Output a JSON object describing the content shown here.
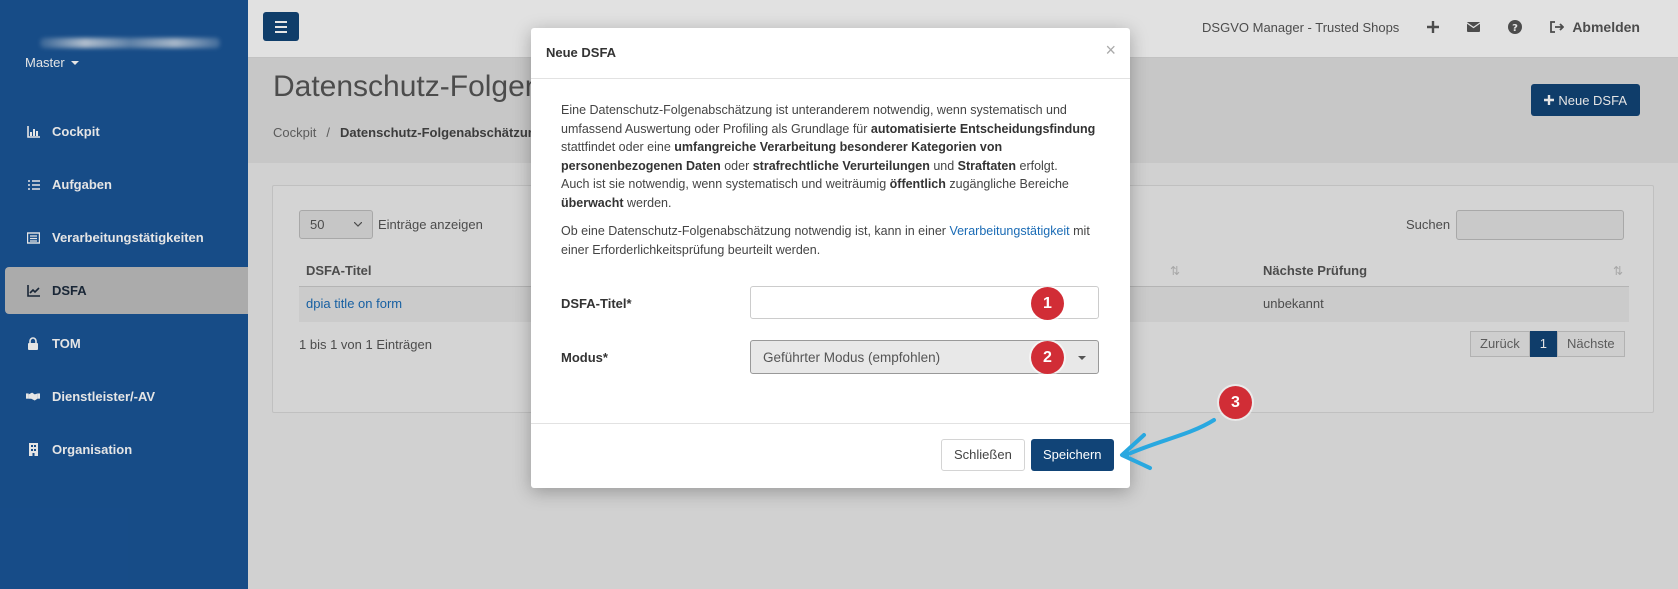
{
  "sidebar": {
    "account": "Master",
    "items": [
      {
        "label": "Cockpit",
        "icon": "chart-icon"
      },
      {
        "label": "Aufgaben",
        "icon": "list-icon"
      },
      {
        "label": "Verarbeitungstätigkeiten",
        "icon": "table-icon"
      },
      {
        "label": "DSFA",
        "icon": "line-chart-icon",
        "active": true
      },
      {
        "label": "TOM",
        "icon": "lock-icon"
      },
      {
        "label": "Dienstleister/-AV",
        "icon": "handshake-icon"
      },
      {
        "label": "Organisation",
        "icon": "building-icon"
      }
    ]
  },
  "topbar": {
    "manager": "DSGVO Manager - Trusted Shops",
    "logout": "Abmelden"
  },
  "page": {
    "title": "Datenschutz-Folgen",
    "breadcrumb_home": "Cockpit",
    "breadcrumb_sep": "/",
    "breadcrumb_current": "Datenschutz-Folgenabschätzung",
    "new_button": "Neue DSFA"
  },
  "table": {
    "length_value": "50",
    "length_label": "Einträge anzeigen",
    "search_label": "Suchen",
    "col_title": "DSFA-Titel",
    "col_next": "Nächste Prüfung",
    "row_title": "dpia title on form",
    "row_next": "unbekannt",
    "info": "1 bis 1 von 1 Einträgen",
    "prev": "Zurück",
    "page": "1",
    "next": "Nächste"
  },
  "modal": {
    "title": "Neue DSFA",
    "close_x": "×",
    "p1_a": "Eine Datenschutz-Folgenabschätzung ist unteranderem notwendig, wenn systematisch und umfassend Auswertung oder Profiling als Grundlage für ",
    "p1_b": "automatisierte Entscheidungsfindung",
    "p1_c": " stattfindet oder eine ",
    "p1_d": "umfangreiche Verarbeitung besonderer Kategorien von personenbezogenen Daten",
    "p1_e": " oder ",
    "p1_f": "strafrechtliche Verurteilungen",
    "p1_g": " und ",
    "p1_h": "Straftaten",
    "p1_i": " erfolgt.",
    "p2_a": "Auch ist sie notwendig, wenn systematisch und weiträumig ",
    "p2_b": "öffentlich",
    "p2_c": " zugängliche Bereiche ",
    "p2_d": "überwacht",
    "p2_e": " werden.",
    "p3_a": "Ob eine Datenschutz-Folgenabschätzung notwendig ist, kann in einer ",
    "p3_link": "Verarbeitungstätigkeit",
    "p3_b": " mit einer Erforderlichkeitsprüfung beurteilt werden.",
    "label_title": "DSFA-Titel*",
    "label_mode": "Modus*",
    "mode_value": "Geführter Modus (empfohlen)",
    "btn_close": "Schließen",
    "btn_save": "Speichern"
  },
  "markers": [
    "1",
    "2",
    "3"
  ],
  "colors": {
    "sidebar": "#1a5597",
    "primary": "#114477",
    "marker": "#d12d36",
    "arrow": "#29a8e0"
  }
}
